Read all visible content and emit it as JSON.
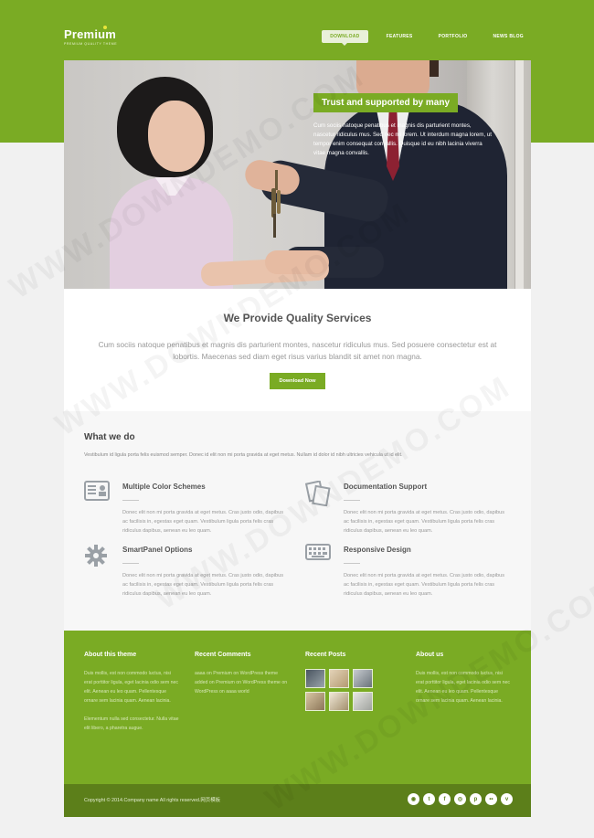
{
  "logo": {
    "title": "Premium",
    "tagline": "PREMIUM QUALITY THEME"
  },
  "nav": {
    "items": [
      "DOWNLOAD",
      "FEATURES",
      "PORTFOLIO",
      "NEWS BLOG"
    ],
    "active_index": 0
  },
  "hero": {
    "title": "Trust and supported by many",
    "text": "Cum sociis natoque penatibus et magnis dis parturient montes, nascetur ridiculus mus. Sed nec mi lorem. Ut interdum magna lorem, ut tempor enim consequat convallis. Quisque id eu nibh lacinia viverra vitae magna convallis."
  },
  "services": {
    "title": "We Provide Quality Services",
    "text": "Cum sociis natoque penatibus et magnis dis parturient montes, nascetur ridiculus mus. Sed posuere consectetur est at lobortis. Maecenas sed diam eget risus varius blandit sit amet non magna.",
    "button": "Download Now"
  },
  "whatwedo": {
    "title": "What we do",
    "intro": "Vestibulum id ligula porta felis euismod semper. Donec id elit non mi porta gravida at eget metus. Nullam id dolor id nibh ultricies vehicula ut id elit.",
    "features": [
      {
        "icon": "id-card-icon",
        "title": "Multiple Color Schemes",
        "text": "Donec elit non mi porta gravida at eget metus. Cras justo odio, dapibus ac facilisis in, egestas eget quam. Vestibulum ligula porta felis cras ridiculus dapibus, aenean eu leo quam."
      },
      {
        "icon": "documents-icon",
        "title": "Documentation Support",
        "text": "Donec elit non mi porta gravida at eget metus. Cras justo odio, dapibus ac facilisis in, egestas eget quam. Vestibulum ligula porta felis cras ridiculus dapibus, aenean eu leo quam."
      },
      {
        "icon": "gear-icon",
        "title": "SmartPanel Options",
        "text": "Donec elit non mi porta gravida at eget metus. Cras justo odio, dapibus ac facilisis in, egestas eget quam. Vestibulum ligula porta felis cras ridiculus dapibus, aenean eu leo quam."
      },
      {
        "icon": "keyboard-icon",
        "title": "Responsive Design",
        "text": "Donec elit non mi porta gravida at eget metus. Cras justo odio, dapibus ac facilisis in, egestas eget quam. Vestibulum ligula porta felis cras ridiculus dapibus, aenean eu leo quam."
      }
    ]
  },
  "footer": {
    "about_theme": {
      "title": "About this theme",
      "p1": "Duis mollis, est non commodo luctus, nisi erat porttitor ligula, eget lacinia odio sem nec elit. Aenean eu leo quam. Pellentesque ornare sem lacinia quam. Aenean lacinia.",
      "p2": "Elementum nulla sed consectetur. Nulla vitae elit libero, a pharetra augue."
    },
    "recent_comments": {
      "title": "Recent Comments",
      "text": "aaaa on Premium on WordPress theme added on Premium on WordPress theme on WordPress on aaaa world"
    },
    "recent_posts": {
      "title": "Recent Posts"
    },
    "about_us": {
      "title": "About us",
      "text": "Duis mollis, est non commodo luctus, nisi erat porttitor ligula, eget lacinia odio sem nec elit. Aenean eu leo quam. Pellentesque ornare sem lacinia quam. Aenean lacinia."
    },
    "copyright": "Copyright © 2014.Company name All rights reserved.网页模板",
    "social": [
      "rss-icon",
      "twitter-icon",
      "facebook-icon",
      "dribbble-icon",
      "pinterest-icon",
      "flickr-icon",
      "vimeo-icon"
    ]
  },
  "colors": {
    "accent": "#7aab24",
    "footer_dark": "#5c7f1a"
  },
  "watermark": "WWW.DOWNDEMO.COM"
}
